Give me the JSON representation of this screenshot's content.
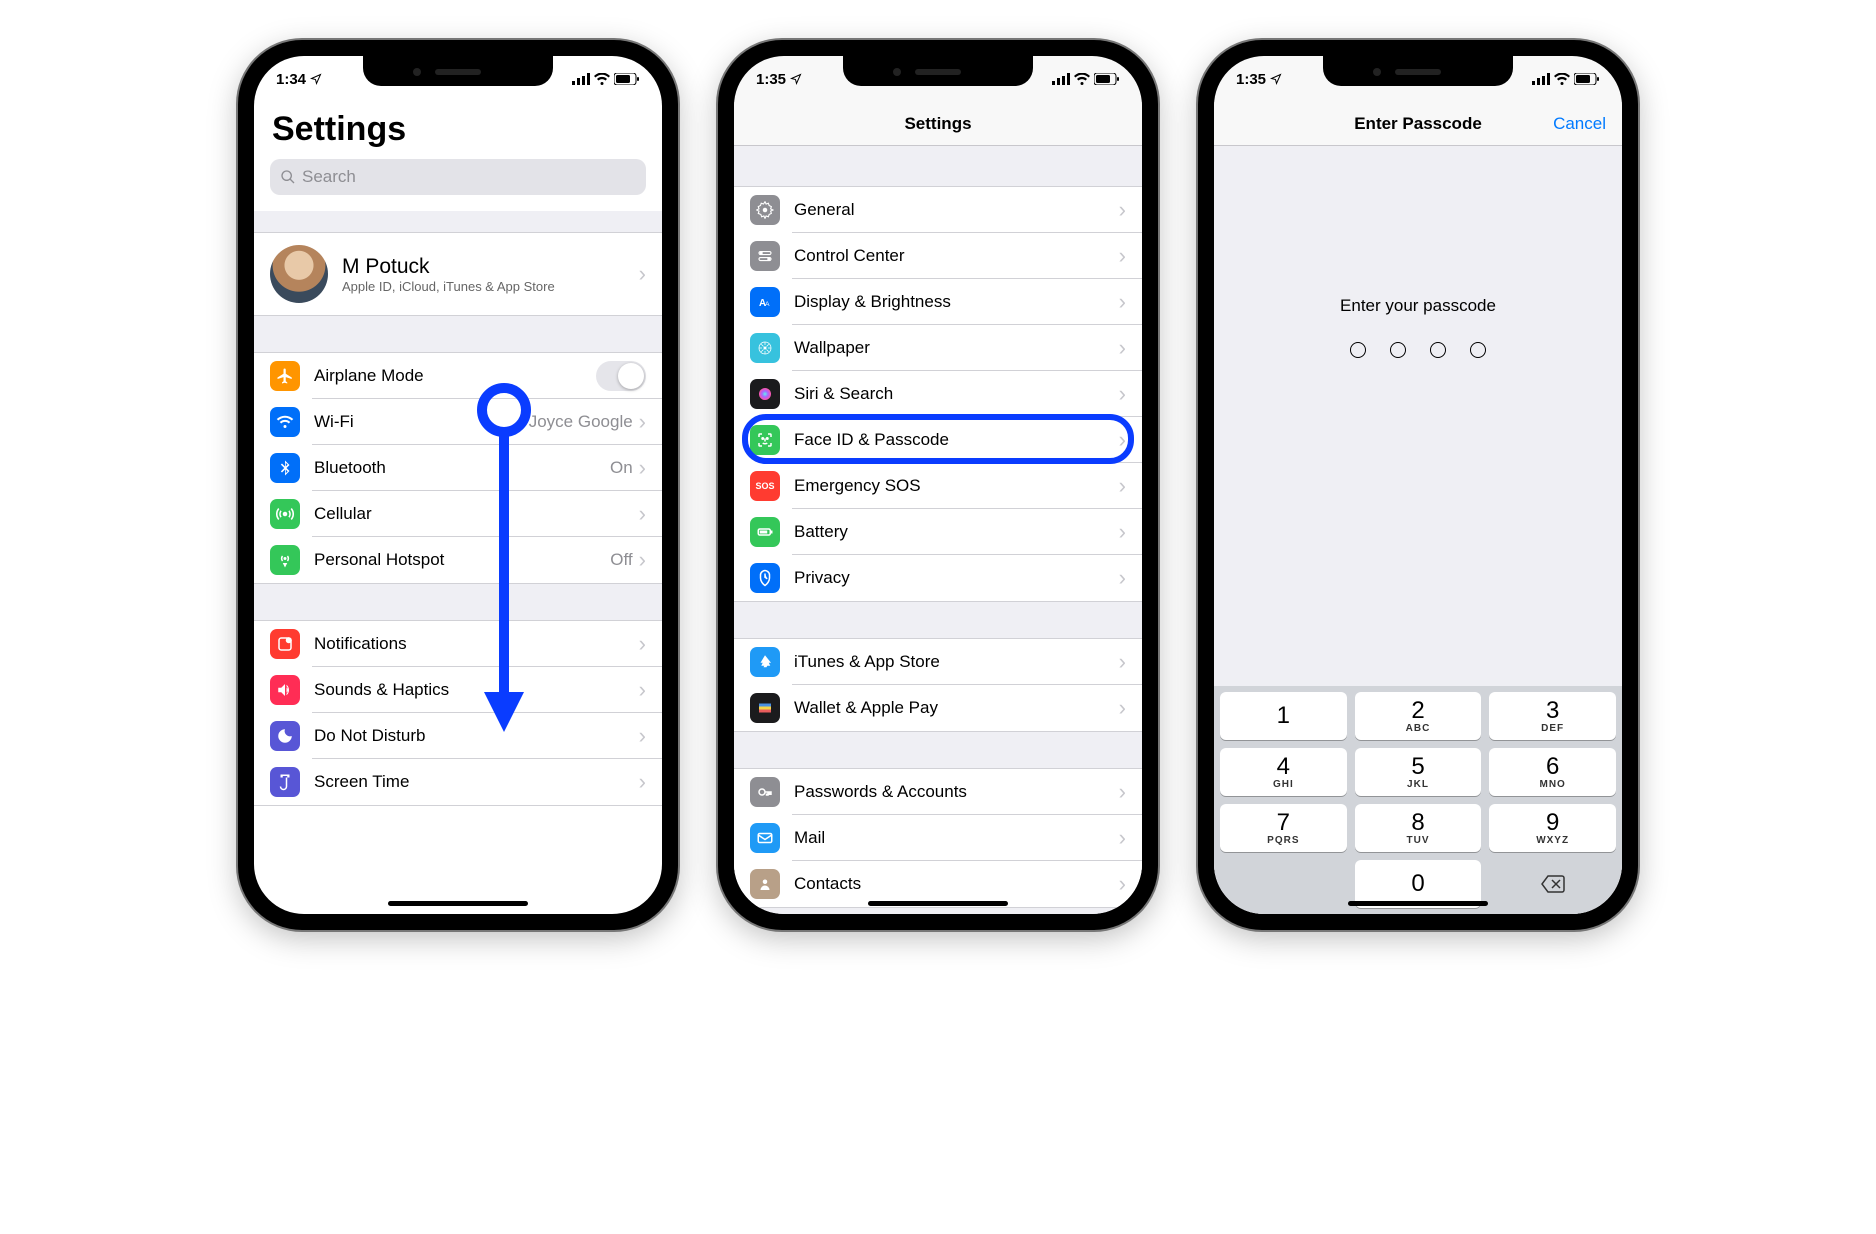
{
  "status": {
    "time1": "1:34",
    "time2": "1:35",
    "time3": "1:35"
  },
  "s1": {
    "title": "Settings",
    "search_placeholder": "Search",
    "profile": {
      "name": "M Potuck",
      "sub": "Apple ID, iCloud, iTunes & App Store"
    },
    "group1": [
      {
        "icon": "airplane-icon",
        "bg": "#ff9500",
        "label": "Airplane Mode",
        "toggle": true
      },
      {
        "icon": "wifi-icon",
        "bg": "#006ff9",
        "label": "Wi-Fi",
        "value": "Joyce Google"
      },
      {
        "icon": "bluetooth-icon",
        "bg": "#006ff9",
        "label": "Bluetooth",
        "value": "On"
      },
      {
        "icon": "cellular-icon",
        "bg": "#34c759",
        "label": "Cellular"
      },
      {
        "icon": "hotspot-icon",
        "bg": "#34c759",
        "label": "Personal Hotspot",
        "value": "Off"
      }
    ],
    "group2": [
      {
        "icon": "notifications-icon",
        "bg": "#ff3b30",
        "label": "Notifications"
      },
      {
        "icon": "sounds-icon",
        "bg": "#ff2d55",
        "label": "Sounds & Haptics"
      },
      {
        "icon": "dnd-icon",
        "bg": "#5856d6",
        "label": "Do Not Disturb"
      },
      {
        "icon": "screentime-icon",
        "bg": "#5856d6",
        "label": "Screen Time"
      }
    ]
  },
  "s2": {
    "nav_title": "Settings",
    "group1": [
      {
        "icon": "general-icon",
        "bg": "#8e8e93",
        "label": "General"
      },
      {
        "icon": "controlcenter-icon",
        "bg": "#8e8e93",
        "label": "Control Center"
      },
      {
        "icon": "display-icon",
        "bg": "#006ff9",
        "label": "Display & Brightness"
      },
      {
        "icon": "wallpaper-icon",
        "bg": "#37c2de",
        "label": "Wallpaper"
      },
      {
        "icon": "siri-icon",
        "bg": "#1b1b1d",
        "label": "Siri & Search"
      },
      {
        "icon": "faceid-icon",
        "bg": "#34c759",
        "label": "Face ID & Passcode",
        "highlight": true
      },
      {
        "icon": "sos-icon",
        "bg": "#ff3b30",
        "label": "Emergency SOS",
        "sos": true
      },
      {
        "icon": "battery-icon",
        "bg": "#34c759",
        "label": "Battery"
      },
      {
        "icon": "privacy-icon",
        "bg": "#006ff9",
        "label": "Privacy"
      }
    ],
    "group2": [
      {
        "icon": "appstore-icon",
        "bg": "#1f9af6",
        "label": "iTunes & App Store"
      },
      {
        "icon": "wallet-icon",
        "bg": "#1b1b1d",
        "label": "Wallet & Apple Pay"
      }
    ],
    "group3": [
      {
        "icon": "passwords-icon",
        "bg": "#8e8e93",
        "label": "Passwords & Accounts"
      },
      {
        "icon": "mail-icon",
        "bg": "#1f9af6",
        "label": "Mail"
      },
      {
        "icon": "contacts-icon",
        "bg": "#b8a088",
        "label": "Contacts"
      }
    ]
  },
  "s3": {
    "nav_title": "Enter Passcode",
    "cancel": "Cancel",
    "prompt": "Enter your passcode",
    "keys": [
      {
        "n": "1",
        "l": ""
      },
      {
        "n": "2",
        "l": "ABC"
      },
      {
        "n": "3",
        "l": "DEF"
      },
      {
        "n": "4",
        "l": "GHI"
      },
      {
        "n": "5",
        "l": "JKL"
      },
      {
        "n": "6",
        "l": "MNO"
      },
      {
        "n": "7",
        "l": "PQRS"
      },
      {
        "n": "8",
        "l": "TUV"
      },
      {
        "n": "9",
        "l": "WXYZ"
      }
    ],
    "key0": "0"
  }
}
